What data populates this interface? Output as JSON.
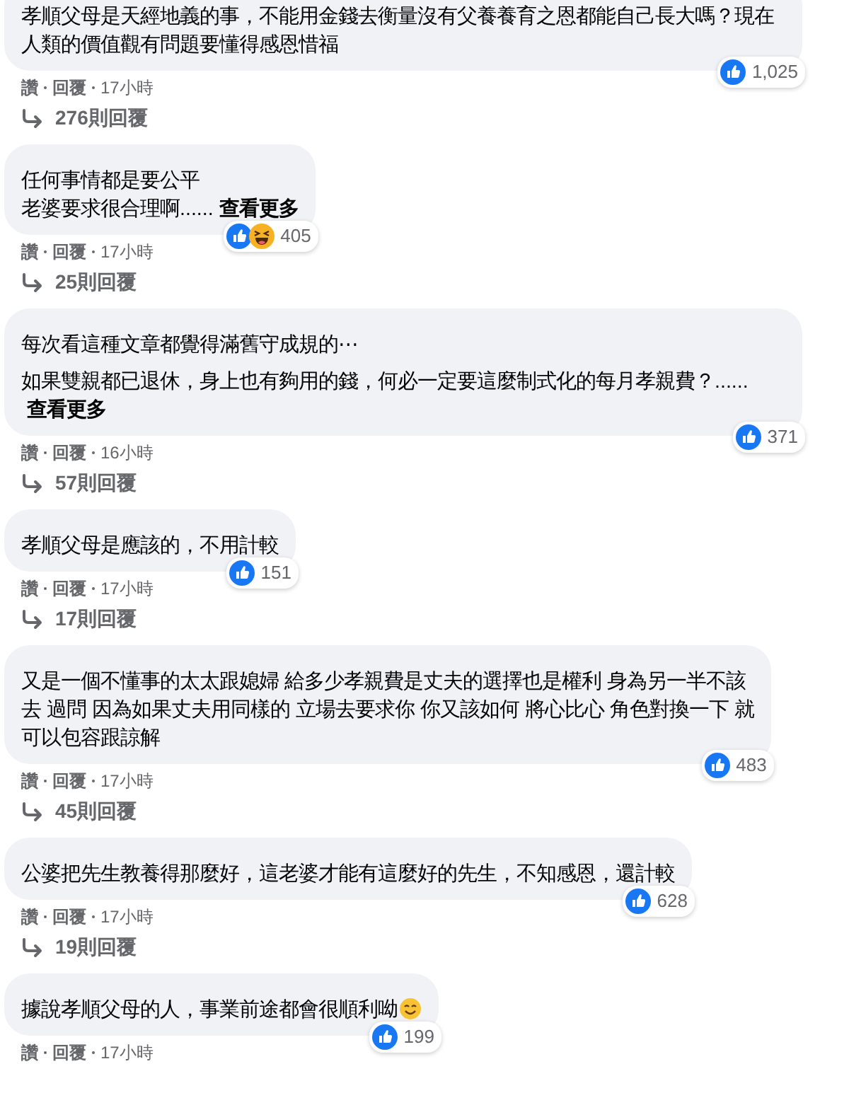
{
  "comments": [
    {
      "paragraphs": [
        [
          "孝順父母是天經地義的事，不能用金錢去衡量沒有父養養育之恩都能自己長大嗎？現在人類的價值觀有問題要懂得感恩惜福"
        ]
      ],
      "emoji": false,
      "reactions": [
        {
          "kind": "like"
        }
      ],
      "reaction_count": "1,025",
      "like": "讚",
      "reply": "回覆",
      "time": "17小時",
      "replies": "276則回覆"
    },
    {
      "paragraphs": [
        [
          "任何事情都是要公平",
          "老婆要求很合理啊......"
        ]
      ],
      "see_more": "查看更多",
      "emoji": false,
      "reactions": [
        {
          "kind": "like"
        },
        {
          "kind": "haha"
        }
      ],
      "reaction_count": "405",
      "like": "讚",
      "reply": "回覆",
      "time": "17小時",
      "replies": "25則回覆"
    },
    {
      "paragraphs": [
        [
          "每次看這種文章都覺得滿舊守成規的⋯"
        ],
        [
          "如果雙親都已退休，身上也有夠用的錢，何必一定要這麼制式化的每月孝親費？......"
        ]
      ],
      "see_more": "查看更多",
      "emoji": false,
      "reactions": [
        {
          "kind": "like"
        }
      ],
      "reaction_count": "371",
      "like": "讚",
      "reply": "回覆",
      "time": "16小時",
      "replies": "57則回覆"
    },
    {
      "paragraphs": [
        [
          "孝順父母是應該的，不用計較"
        ]
      ],
      "emoji": false,
      "reactions": [
        {
          "kind": "like"
        }
      ],
      "reaction_count": "151",
      "like": "讚",
      "reply": "回覆",
      "time": "17小時",
      "replies": "17則回覆"
    },
    {
      "paragraphs": [
        [
          "又是一個不懂事的太太跟媳婦 給多少孝親費是丈夫的選擇也是權利 身為另一半不該",
          "去 過問 因為如果丈夫用同樣的 立場去要求你 你又該如何 將心比心 角色對換一下 就",
          "可以包容跟諒解"
        ]
      ],
      "emoji": false,
      "reactions": [
        {
          "kind": "like"
        }
      ],
      "reaction_count": "483",
      "like": "讚",
      "reply": "回覆",
      "time": "17小時",
      "replies": "45則回覆"
    },
    {
      "paragraphs": [
        [
          "公婆把先生教養得那麼好，這老婆才能有這麼好的先生，不知感恩，還計較"
        ]
      ],
      "emoji": false,
      "reactions": [
        {
          "kind": "like"
        }
      ],
      "reaction_count": "628",
      "like": "讚",
      "reply": "回覆",
      "time": "17小時",
      "replies": "19則回覆"
    },
    {
      "paragraphs": [
        [
          "據說孝順父母的人，事業前途都會很順利呦"
        ]
      ],
      "emoji": true,
      "reactions": [
        {
          "kind": "like"
        }
      ],
      "reaction_count": "199",
      "like": "讚",
      "reply": "回覆",
      "time": "17小時"
    }
  ]
}
